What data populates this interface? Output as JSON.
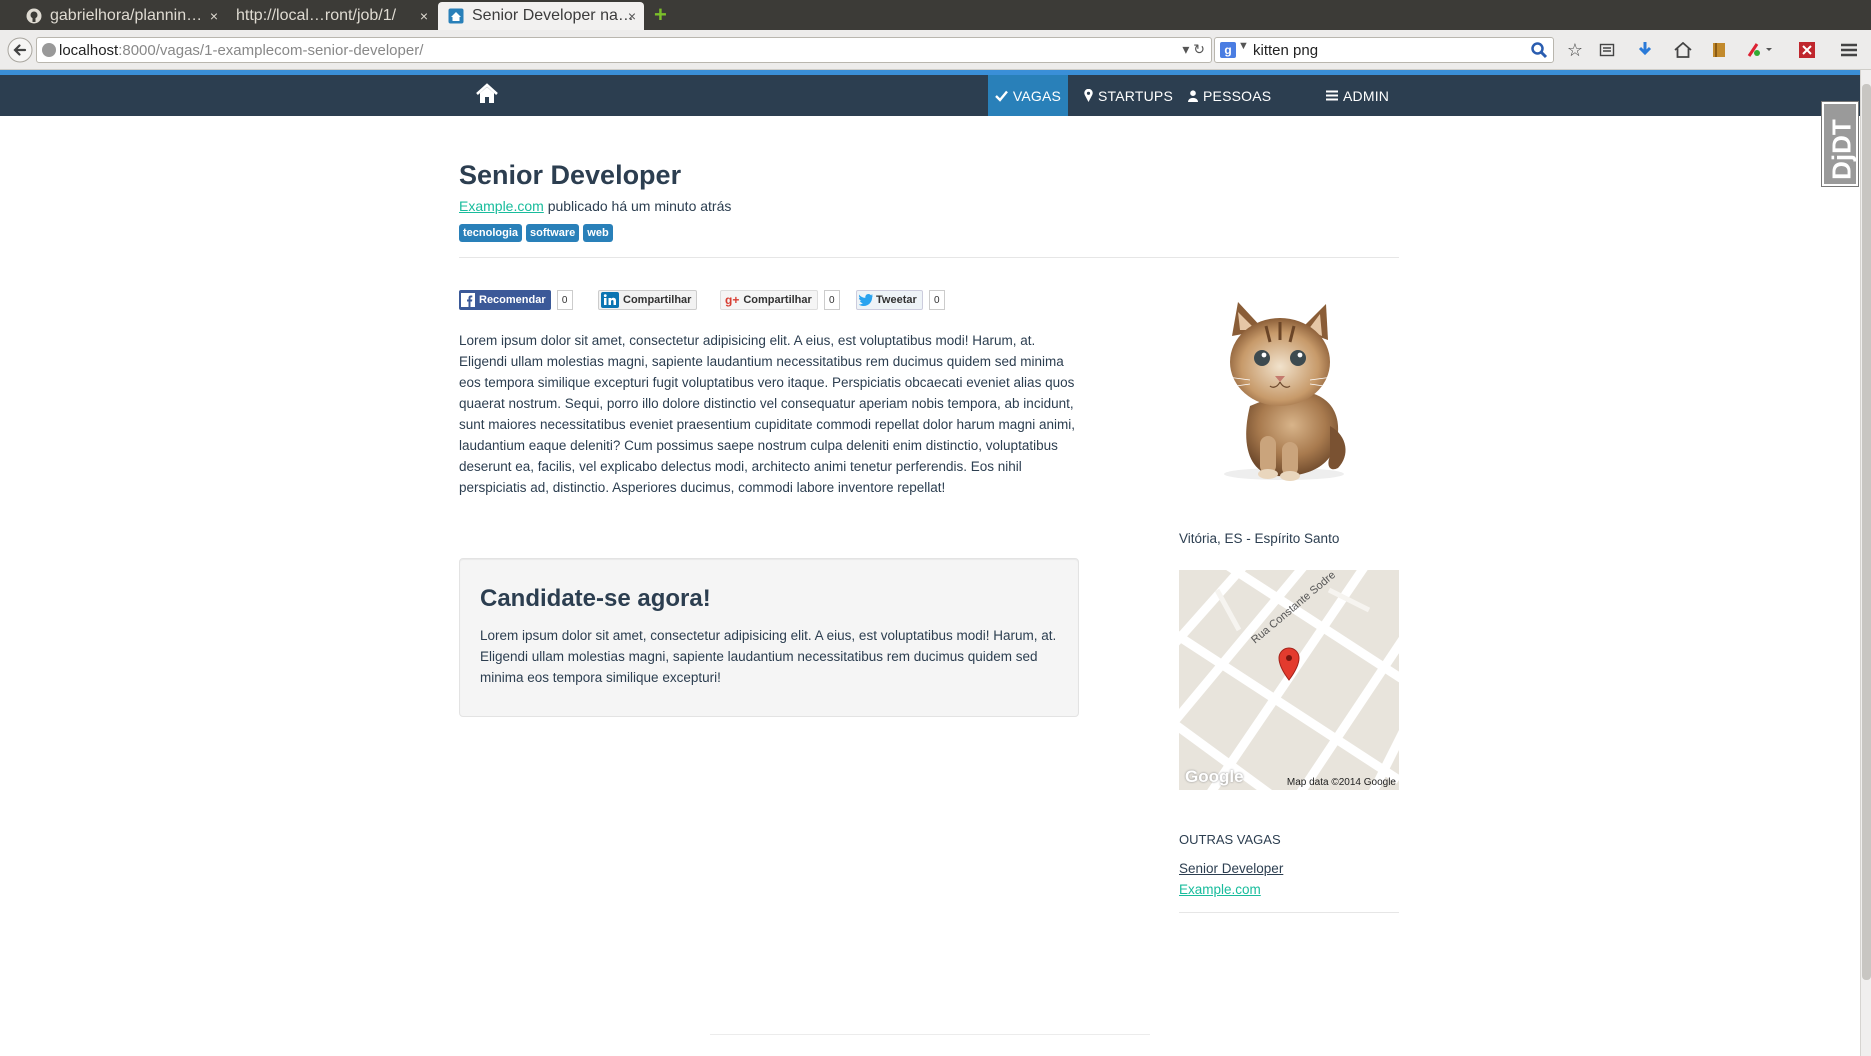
{
  "browser": {
    "tabs": [
      {
        "label": "gabrielhora/plannin…",
        "close": "×",
        "active": false
      },
      {
        "label": "http://local…ront/job/1/",
        "close": "×",
        "active": false
      },
      {
        "label": "Senior Developer na…",
        "close": "×",
        "active": true
      }
    ],
    "new_tab": "+",
    "url_host": "localhost",
    "url_rest": ":8000/vagas/1-examplecom-senior-developer/",
    "search_text": "kitten png"
  },
  "site_nav": {
    "items": [
      {
        "label": "VAGAS",
        "icon": "check-icon",
        "active": true
      },
      {
        "label": "STARTUPS",
        "icon": "map-marker-icon",
        "active": false
      },
      {
        "label": "PESSOAS",
        "icon": "user-icon",
        "active": false
      },
      {
        "label": "ADMIN",
        "icon": "menu-icon",
        "active": false
      }
    ]
  },
  "ddt_label": "DjDT",
  "job": {
    "title": "Senior Developer",
    "company": "Example.com",
    "posted": "publicado há um minuto atrás",
    "tags": [
      "tecnologia",
      "software",
      "web"
    ],
    "description": "Lorem ipsum dolor sit amet, consectetur adipisicing elit. A eius, est voluptatibus modi! Harum, at. Eligendi ullam molestias magni, sapiente laudantium necessitatibus rem ducimus quidem sed minima eos tempora similique excepturi fugit voluptatibus vero itaque. Perspiciatis obcaecati eveniet alias quos quaerat nostrum. Sequi, porro illo dolore distinctio vel consequatur aperiam nobis tempora, ab incidunt, sunt maiores necessitatibus eveniet praesentium cupiditate commodi repellat dolor harum magni animi, laudantium eaque deleniti? Cum possimus saepe nostrum culpa deleniti enim distinctio, voluptatibus deserunt ea, facilis, vel explicabo delectus modi, architecto animi tenetur perferendis. Eos nihil perspiciatis ad, distinctio. Asperiores ducimus, commodi labore inventore repellat!"
  },
  "share": {
    "facebook": {
      "label": "Recomendar",
      "count": "0"
    },
    "linkedin": {
      "label": "Compartilhar"
    },
    "gplus": {
      "label": "Compartilhar",
      "count": "0"
    },
    "twitter": {
      "label": "Tweetar",
      "count": "0"
    }
  },
  "apply": {
    "title": "Candidate-se agora!",
    "text": "Lorem ipsum dolor sit amet, consectetur adipisicing elit. A eius, est voluptatibus modi! Harum, at. Eligendi ullam molestias magni, sapiente laudantium necessitatibus rem ducimus quidem sed minima eos tempora similique excepturi!"
  },
  "sidebar": {
    "location": "Vitória, ES - Espírito Santo",
    "map_street": "Rua Constante Sodre",
    "map_credit": "Map data ©2014 Google",
    "map_logo": "Google",
    "others_heading": "OUTRAS VAGAS",
    "others": [
      {
        "title": "Senior Developer",
        "company": "Example.com"
      }
    ]
  },
  "colors": {
    "nav_bg": "#2c3e50",
    "nav_active": "#2980b9",
    "link": "#18bc9c",
    "tag": "#2980b9"
  }
}
